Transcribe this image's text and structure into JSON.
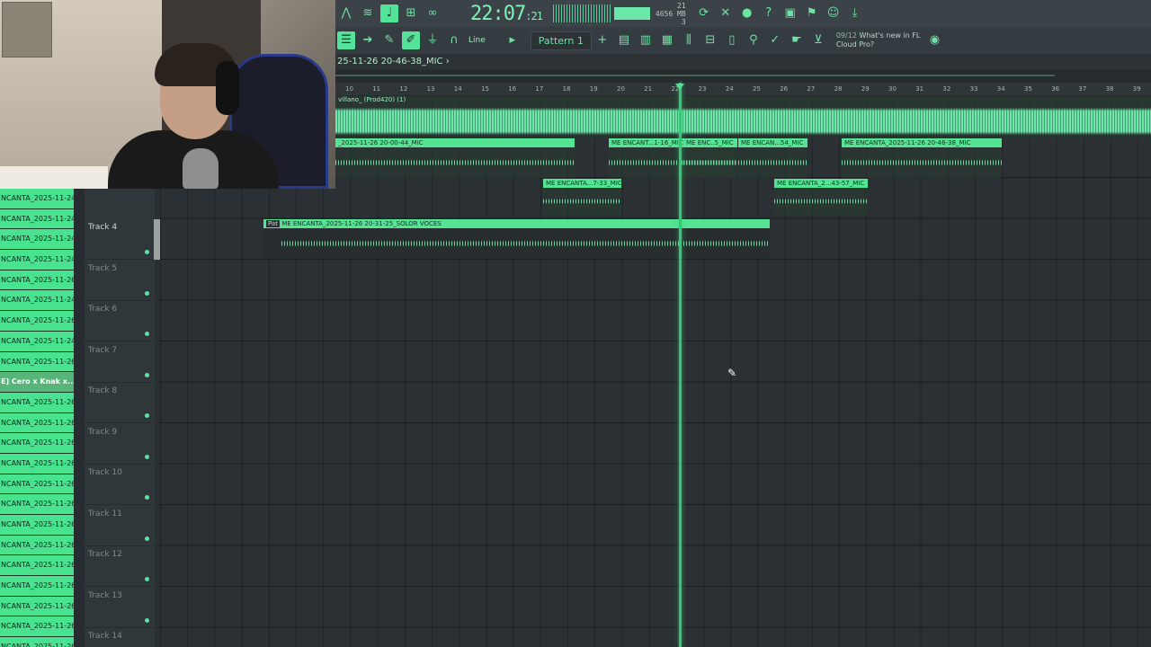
{
  "toolbar": {
    "clock_main": "22:07",
    "clock_sec": ":21",
    "cpu_top": "21",
    "cpu_mem": "4656 MB",
    "cpu_poly": "3",
    "snap_label": "Line",
    "pattern_label": "Pattern 1",
    "news_count": "09/12",
    "news_title": "What's new in FL",
    "news_sub": "Cloud Pro?"
  },
  "project": {
    "title": "25-11-26 20-46-38_MIC"
  },
  "ruler": {
    "bars": [
      "10",
      "11",
      "12",
      "13",
      "14",
      "15",
      "16",
      "17",
      "18",
      "19",
      "20",
      "21",
      "22",
      "23",
      "24",
      "25",
      "26",
      "27",
      "28",
      "29",
      "30",
      "31",
      "32",
      "33",
      "34",
      "35",
      "36",
      "37",
      "38",
      "39"
    ]
  },
  "clips": {
    "main_audio": "villano_ (Prod420) (1)",
    "c1": "_2025-11-26 20-00-44_MIC",
    "c2": "ME ENCANT...1-16_MIC",
    "c3": "ME ENC..5_MIC",
    "c4": "ME ENCAN...54_MIC",
    "c5": "ME ENCANTA_2025-11-26 20-46-38_MIC",
    "c6": "ME ENCANTA...7-33_MIC",
    "c7": "ME ENCANTA_2...43-57_MIC",
    "c8_prefix": "Pat",
    "c8": "ME ENCANTA_2025-11-26 20-31-25_SOLOR VOCES"
  },
  "picker": {
    "items": [
      "NCANTA_2025-11-24",
      "NCANTA_2025-11-24",
      "NCANTA_2025-11-24",
      "NCANTA_2025-11-24",
      "NCANTA_2025-11-26",
      "NCANTA_2025-11-24",
      "NCANTA_2025-11-26",
      "NCANTA_2025-11-24",
      "NCANTA_2025-11-26",
      "E] Cero x Knak x...",
      "NCANTA_2025-11-26",
      "NCANTA_2025-11-26",
      "NCANTA_2025-11-26",
      "NCANTA_2025-11-26",
      "NCANTA_2025-11-26",
      "NCANTA_2025-11-26",
      "NCANTA_2025-11-26",
      "NCANTA_2025-11-26",
      "NCANTA_2025-11-26",
      "NCANTA_2025-11-26",
      "NCANTA_2025-11-26",
      "NCANTA_2025-11-26",
      "NCANTA_2025-11-26"
    ]
  },
  "tracks": [
    {
      "label": "Track 4"
    },
    {
      "label": "Track 5"
    },
    {
      "label": "Track 6"
    },
    {
      "label": "Track 7"
    },
    {
      "label": "Track 8"
    },
    {
      "label": "Track 9"
    },
    {
      "label": "Track 10"
    },
    {
      "label": "Track 11"
    },
    {
      "label": "Track 12"
    },
    {
      "label": "Track 13"
    },
    {
      "label": "Track 14"
    }
  ],
  "colors": {
    "accent": "#55e394",
    "playhead": "#36c874",
    "background": "#2a3034"
  }
}
